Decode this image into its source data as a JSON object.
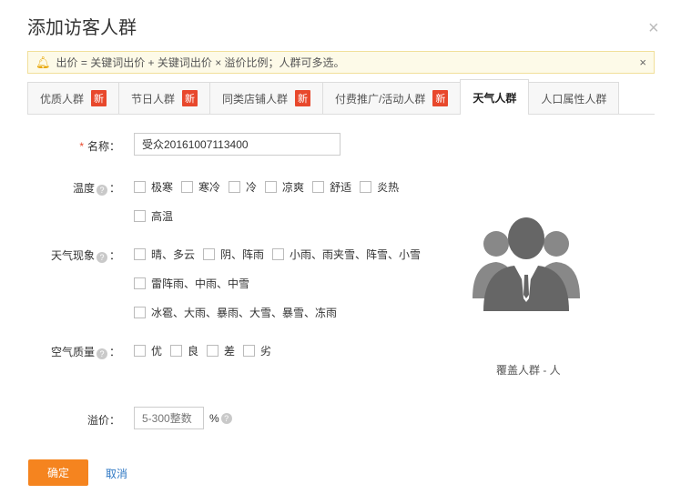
{
  "dialog": {
    "title": "添加访客人群",
    "close": "×"
  },
  "notice": {
    "text": "出价 = 关键词出价 + 关键词出价 × 溢价比例；人群可多选。",
    "close": "×"
  },
  "tabs": [
    {
      "label": "优质人群",
      "badge": "新"
    },
    {
      "label": "节日人群",
      "badge": "新"
    },
    {
      "label": "同类店铺人群",
      "badge": "新"
    },
    {
      "label": "付费推广/活动人群",
      "badge": "新"
    },
    {
      "label": "天气人群",
      "active": true
    },
    {
      "label": "人口属性人群"
    }
  ],
  "form": {
    "name": {
      "required": "*",
      "label": "名称：",
      "value": "受众20161007113400"
    },
    "temperature": {
      "label": "温度",
      "colon": "：",
      "options": [
        "极寒",
        "寒冷",
        "冷",
        "凉爽",
        "舒适",
        "炎热",
        "高温"
      ]
    },
    "weather": {
      "label": "天气现象",
      "colon": "：",
      "options": [
        "晴、多云",
        "阴、阵雨",
        "小雨、雨夹雪、阵雪、小雪",
        "雷阵雨、中雨、中雪",
        "冰雹、大雨、暴雨、大雪、暴雪、冻雨"
      ]
    },
    "air": {
      "label": "空气质量",
      "colon": "：",
      "options": [
        "优",
        "良",
        "差",
        "劣"
      ]
    },
    "premium": {
      "label": "溢价：",
      "placeholder": "5-300整数",
      "unit": "%"
    }
  },
  "coverage": {
    "text": "覆盖人群 - 人"
  },
  "help_glyph": "?",
  "buttons": {
    "confirm": "确定",
    "cancel": "取消"
  }
}
